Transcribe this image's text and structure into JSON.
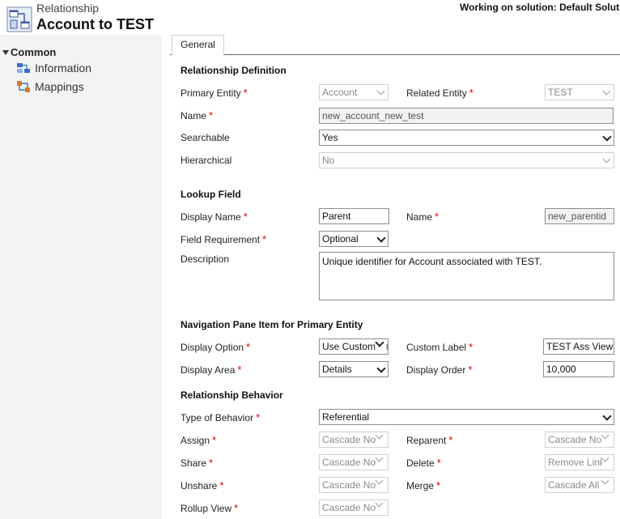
{
  "header": {
    "subtitle": "Relationship",
    "title": "Account to TEST",
    "solution": "Working on solution: Default Solut",
    "icon": "relationship-icon"
  },
  "sidebar": {
    "group": "Common",
    "items": [
      {
        "label": "Information",
        "icon": "information-icon"
      },
      {
        "label": "Mappings",
        "icon": "mappings-icon"
      }
    ]
  },
  "tabs": [
    {
      "label": "General"
    }
  ],
  "colors": {
    "required": "#dd0000",
    "sidebar_bg": "#f3f3f3"
  },
  "relationship_definition": {
    "heading": "Relationship Definition",
    "primary_entity": {
      "label": "Primary Entity",
      "value": "Account"
    },
    "related_entity": {
      "label": "Related Entity",
      "value": "TEST"
    },
    "name": {
      "label": "Name",
      "value": "new_account_new_test"
    },
    "searchable": {
      "label": "Searchable",
      "value": "Yes"
    },
    "hierarchical": {
      "label": "Hierarchical",
      "value": "No"
    }
  },
  "lookup_field": {
    "heading": "Lookup Field",
    "display_name": {
      "label": "Display Name",
      "value": "Parent"
    },
    "name": {
      "label": "Name",
      "value": "new_parentid"
    },
    "field_requirement": {
      "label": "Field Requirement",
      "value": "Optional"
    },
    "description": {
      "label": "Description",
      "value": "Unique identifier for Account associated with TEST."
    }
  },
  "navigation_pane": {
    "heading": "Navigation Pane Item for Primary Entity",
    "display_option": {
      "label": "Display Option",
      "value": "Use Custom Label"
    },
    "custom_label": {
      "label": "Custom Label",
      "value": "TEST Ass View"
    },
    "display_area": {
      "label": "Display Area",
      "value": "Details"
    },
    "display_order": {
      "label": "Display Order",
      "value": "10,000"
    }
  },
  "relationship_behavior": {
    "heading": "Relationship Behavior",
    "type_of_behavior": {
      "label": "Type of Behavior",
      "value": "Referential"
    },
    "assign": {
      "label": "Assign",
      "value": "Cascade None"
    },
    "reparent": {
      "label": "Reparent",
      "value": "Cascade None"
    },
    "share": {
      "label": "Share",
      "value": "Cascade None"
    },
    "delete": {
      "label": "Delete",
      "value": "Remove Link"
    },
    "unshare": {
      "label": "Unshare",
      "value": "Cascade None"
    },
    "merge": {
      "label": "Merge",
      "value": "Cascade All"
    },
    "rollup_view": {
      "label": "Rollup View",
      "value": "Cascade None"
    }
  }
}
